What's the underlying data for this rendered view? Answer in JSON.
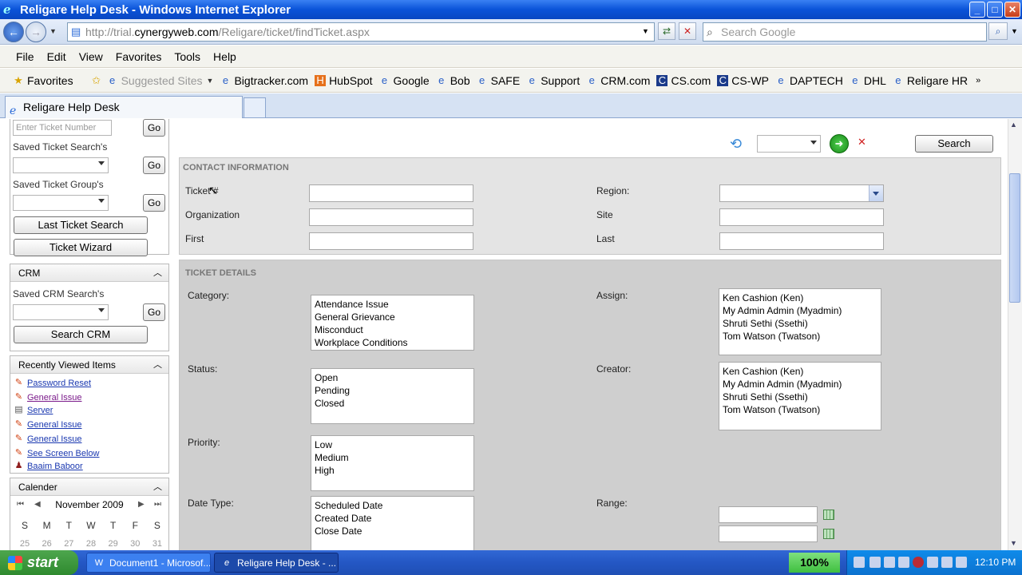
{
  "window": {
    "title": "Religare Help Desk - Windows Internet Explorer"
  },
  "address": {
    "url_prefix": "http://trial.",
    "url_host": "cynergyweb.com",
    "url_path": "/Religare/ticket/findTicket.aspx",
    "search_placeholder": "Search Google"
  },
  "menu": [
    "File",
    "Edit",
    "View",
    "Favorites",
    "Tools",
    "Help"
  ],
  "favorites": {
    "label": "Favorites",
    "suggested": "Suggested Sites",
    "links": [
      "Bigtracker.com",
      "HubSpot",
      "Google",
      "Bob",
      "SAFE",
      "Support",
      "CRM.com",
      "CS.com",
      "CS-WP",
      "DAPTECH",
      "DHL",
      "Religare HR"
    ]
  },
  "tab": {
    "title": "Religare Help Desk"
  },
  "left": {
    "ticket_number_placeholder": "Enter Ticket Number",
    "go": "Go",
    "saved_ticket_searches": "Saved Ticket Search's",
    "saved_ticket_groups": "Saved Ticket Group's",
    "last_ticket_search": "Last Ticket Search",
    "ticket_wizard": "Ticket Wizard",
    "crm_title": "CRM",
    "saved_crm_searches": "Saved CRM Search's",
    "search_crm": "Search CRM",
    "recent_title": "Recently Viewed Items",
    "recent_items": [
      "Password Reset",
      "General Issue",
      "Server",
      "General Issue",
      "General Issue",
      "See Screen Below",
      "Baaim Baboor"
    ],
    "calendar_title": "Calender",
    "calendar_month": "November 2009",
    "calendar_days": [
      "S",
      "M",
      "T",
      "W",
      "T",
      "F",
      "S"
    ],
    "calendar_week1": [
      "25",
      "26",
      "27",
      "28",
      "29",
      "30",
      "31"
    ]
  },
  "form": {
    "search_button": "Search",
    "contact_header": "CONTACT INFORMATION",
    "ticket_label": "Ticket #",
    "organization_label": "Organization",
    "first_label": "First",
    "region_label": "Region:",
    "site_label": "Site",
    "last_label": "Last",
    "details_header": "TICKET DETAILS",
    "category_label": "Category:",
    "categories": [
      "Attendance Issue",
      "General Grievance",
      "Misconduct",
      "Workplace Conditions"
    ],
    "assign_label": "Assign:",
    "assignees": [
      "Ken Cashion (Ken)",
      "My Admin Admin (Myadmin)",
      "Shruti Sethi (Ssethi)",
      "Tom Watson (Twatson)"
    ],
    "status_label": "Status:",
    "statuses": [
      "Open",
      "Pending",
      "Closed"
    ],
    "creator_label": "Creator:",
    "creators": [
      "Ken Cashion (Ken)",
      "My Admin Admin (Myadmin)",
      "Shruti Sethi (Ssethi)",
      "Tom Watson (Twatson)"
    ],
    "priority_label": "Priority:",
    "priorities": [
      "Low",
      "Medium",
      "High"
    ],
    "date_type_label": "Date Type:",
    "date_types": [
      "Scheduled Date",
      "Created Date",
      "Close Date"
    ],
    "range_label": "Range:"
  },
  "taskbar": {
    "start": "start",
    "items": [
      "Document1 - Microsof...",
      "Religare Help Desk - ..."
    ],
    "zoom": "100%",
    "clock": "12:10 PM"
  },
  "colors": {
    "titlebar": "#0a53d8",
    "taskbar": "#2457c4",
    "start": "#3c9a3c",
    "link": "#1a38b0"
  }
}
